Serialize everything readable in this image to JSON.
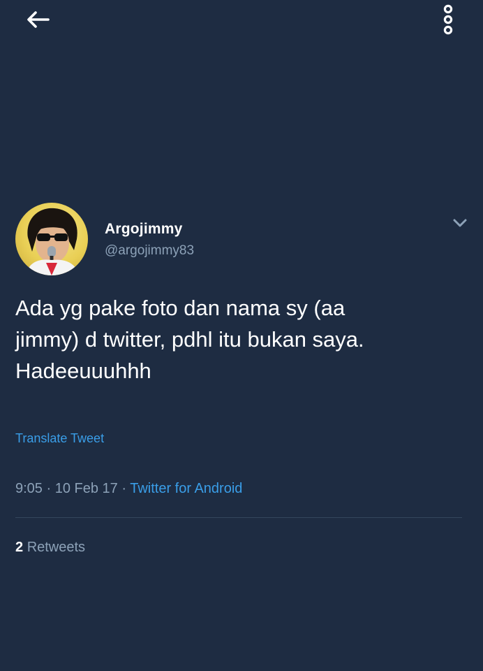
{
  "header": {
    "back_icon": "arrow-left-icon",
    "more_icon": "vertical-more-icon"
  },
  "tweet": {
    "avatar_icon": "profile-photo",
    "display_name": "Argojimmy",
    "handle": "@argojimmy83",
    "caret_icon": "chevron-down-icon",
    "text": "Ada yg pake foto dan nama sy (aa\njimmy) d twitter, pdhl itu bukan saya.\nHadeeuuuhhh",
    "translate_label": "Translate Tweet",
    "time": "9:05",
    "date": "10 Feb 17",
    "source": "Twitter for Android",
    "retweet_count": "2",
    "retweet_label": "Retweets"
  },
  "colors": {
    "background": "#1e2c42",
    "link": "#3a9ee8",
    "secondary_text": "#8da2b8",
    "divider": "#34465c"
  }
}
